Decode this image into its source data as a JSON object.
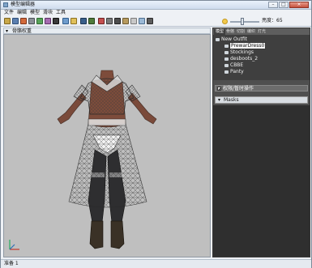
{
  "window": {
    "title": "模型编辑器",
    "minimize": "–",
    "maximize": "□",
    "close": "×"
  },
  "menu": [
    "文件",
    "编辑",
    "模型",
    "滑块",
    "工具"
  ],
  "toolbar": {
    "brightness_label": "亮度：",
    "brightness_value": "65"
  },
  "viewport": {
    "collapse_glyph": "▾",
    "title": "骨骼权重"
  },
  "panel": {
    "tabs": [
      "模型",
      "骨骼",
      "切割",
      "编织",
      "灯光"
    ],
    "tree": {
      "root": "New Outfit",
      "items": [
        "PrewarDress0",
        "Stockings",
        "desboots_2",
        "CBBE",
        "Panty"
      ],
      "selected_index": 0
    },
    "mirror_label": "权限/暂时操作",
    "mirror_checked": true,
    "masks_glyph": "▾",
    "masks_title": "Masks"
  },
  "status": {
    "text": "准备 1"
  },
  "colors": {
    "viewport_bg": "#bfbfbf",
    "panel_bg": "#4f4f4f",
    "tree_bg": "#3f3f3f",
    "accent": "#7fa4c9"
  }
}
